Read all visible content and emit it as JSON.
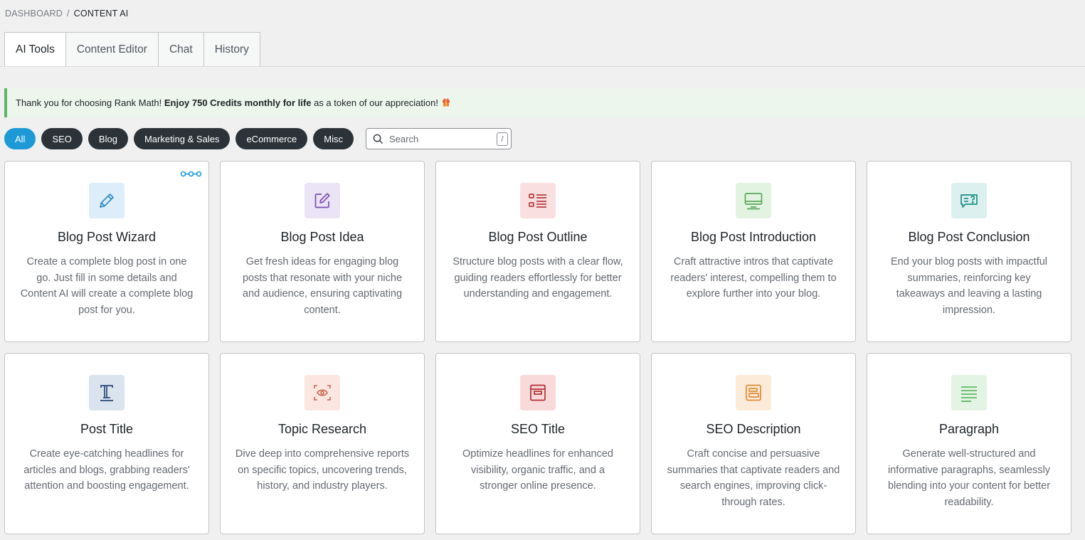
{
  "breadcrumb": {
    "root": "DASHBOARD",
    "separator": "/",
    "current": "CONTENT AI"
  },
  "tabs": [
    {
      "label": "AI Tools",
      "active": true
    },
    {
      "label": "Content Editor",
      "active": false
    },
    {
      "label": "Chat",
      "active": false
    },
    {
      "label": "History",
      "active": false
    }
  ],
  "notice": {
    "text_before": "Thank you for choosing Rank Math!",
    "text_bold": "Enjoy 750 Credits monthly for life",
    "text_after": "as a token of our appreciation!",
    "icon": "gift-icon"
  },
  "filters": [
    {
      "label": "All",
      "active": true
    },
    {
      "label": "SEO",
      "active": false
    },
    {
      "label": "Blog",
      "active": false
    },
    {
      "label": "Marketing & Sales",
      "active": false
    },
    {
      "label": "eCommerce",
      "active": false
    },
    {
      "label": "Misc",
      "active": false
    }
  ],
  "search": {
    "placeholder": "Search",
    "shortcut": "/"
  },
  "cards": [
    {
      "title": "Blog Post Wizard",
      "description": "Create a complete blog post in one go. Just fill in some details and Content AI will create a complete blog post for you.",
      "icon": "pencil-icon",
      "icon_bg": "#ddeefa",
      "icon_color": "#2b8ac4",
      "badge": "workflow-icon"
    },
    {
      "title": "Blog Post Idea",
      "description": "Get fresh ideas for engaging blog posts that resonate with your niche and audience, ensuring captivating content.",
      "icon": "edit-square-icon",
      "icon_bg": "#ebe3f6",
      "icon_color": "#7c4fb2"
    },
    {
      "title": "Blog Post Outline",
      "description": "Structure blog posts with a clear flow, guiding readers effortlessly for better understanding and engagement.",
      "icon": "list-icon",
      "icon_bg": "#f9dfe0",
      "icon_color": "#b33a3e"
    },
    {
      "title": "Blog Post Introduction",
      "description": "Craft attractive intros that captivate readers' interest, compelling them to explore further into your blog.",
      "icon": "monitor-icon",
      "icon_bg": "#e3f3e1",
      "icon_color": "#5aa85a"
    },
    {
      "title": "Blog Post Conclusion",
      "description": "End your blog posts with impactful summaries, reinforcing key takeaways and leaving a lasting impression.",
      "icon": "chat-question-icon",
      "icon_bg": "#dcf1ef",
      "icon_color": "#1e8e86"
    },
    {
      "title": "Post Title",
      "description": "Create eye-catching headlines for articles and blogs, grabbing readers' attention and boosting engagement.",
      "icon": "text-t-icon",
      "icon_bg": "#dae3ee",
      "icon_color": "#2a4a7a"
    },
    {
      "title": "Topic Research",
      "description": "Dive deep into comprehensive reports on specific topics, uncovering trends, history, and industry players.",
      "icon": "eye-scan-icon",
      "icon_bg": "#fbe6e2",
      "icon_color": "#c8664e"
    },
    {
      "title": "SEO Title",
      "description": "Optimize headlines for enhanced visibility, organic traffic, and a stronger online presence.",
      "icon": "title-box-icon",
      "icon_bg": "#f9dadb",
      "icon_color": "#b22f35"
    },
    {
      "title": "SEO Description",
      "description": "Craft concise and persuasive summaries that captivate readers and search engines, improving click-through rates.",
      "icon": "description-box-icon",
      "icon_bg": "#fdebd9",
      "icon_color": "#e08a35"
    },
    {
      "title": "Paragraph",
      "description": "Generate well-structured and informative paragraphs, seamlessly blending into your content for better readability.",
      "icon": "paragraph-lines-icon",
      "icon_bg": "#e3f3e4",
      "icon_color": "#4caf50"
    }
  ]
}
